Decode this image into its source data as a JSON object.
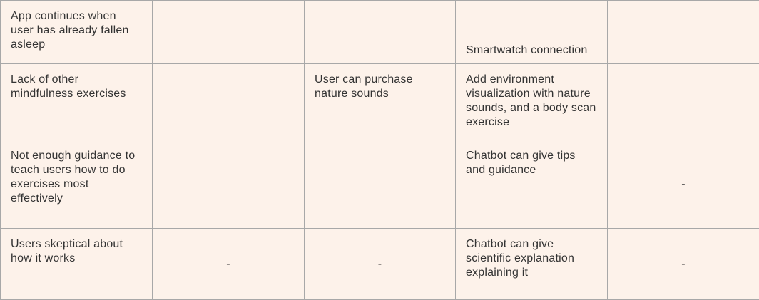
{
  "rows": [
    {
      "problem": "App continues when user has already fallen asleep",
      "col2": "",
      "col3": "",
      "col4": "Smartwatch connection",
      "col5": ""
    },
    {
      "problem": "Lack of other mindfulness exercises",
      "col2": "",
      "col3": "User can purchase nature sounds",
      "col4": "Add environment visualization with nature sounds, and a body scan exercise",
      "col5": ""
    },
    {
      "problem": "Not enough guidance to teach users how to do exercises most effectively",
      "col2": "",
      "col3": "",
      "col4": "Chatbot can give tips and guidance",
      "col5": "-"
    },
    {
      "problem": "Users skeptical about how it works",
      "col2": "-",
      "col3": "-",
      "col4": "Chatbot can give scientific explanation explaining it",
      "col5": "-"
    }
  ]
}
